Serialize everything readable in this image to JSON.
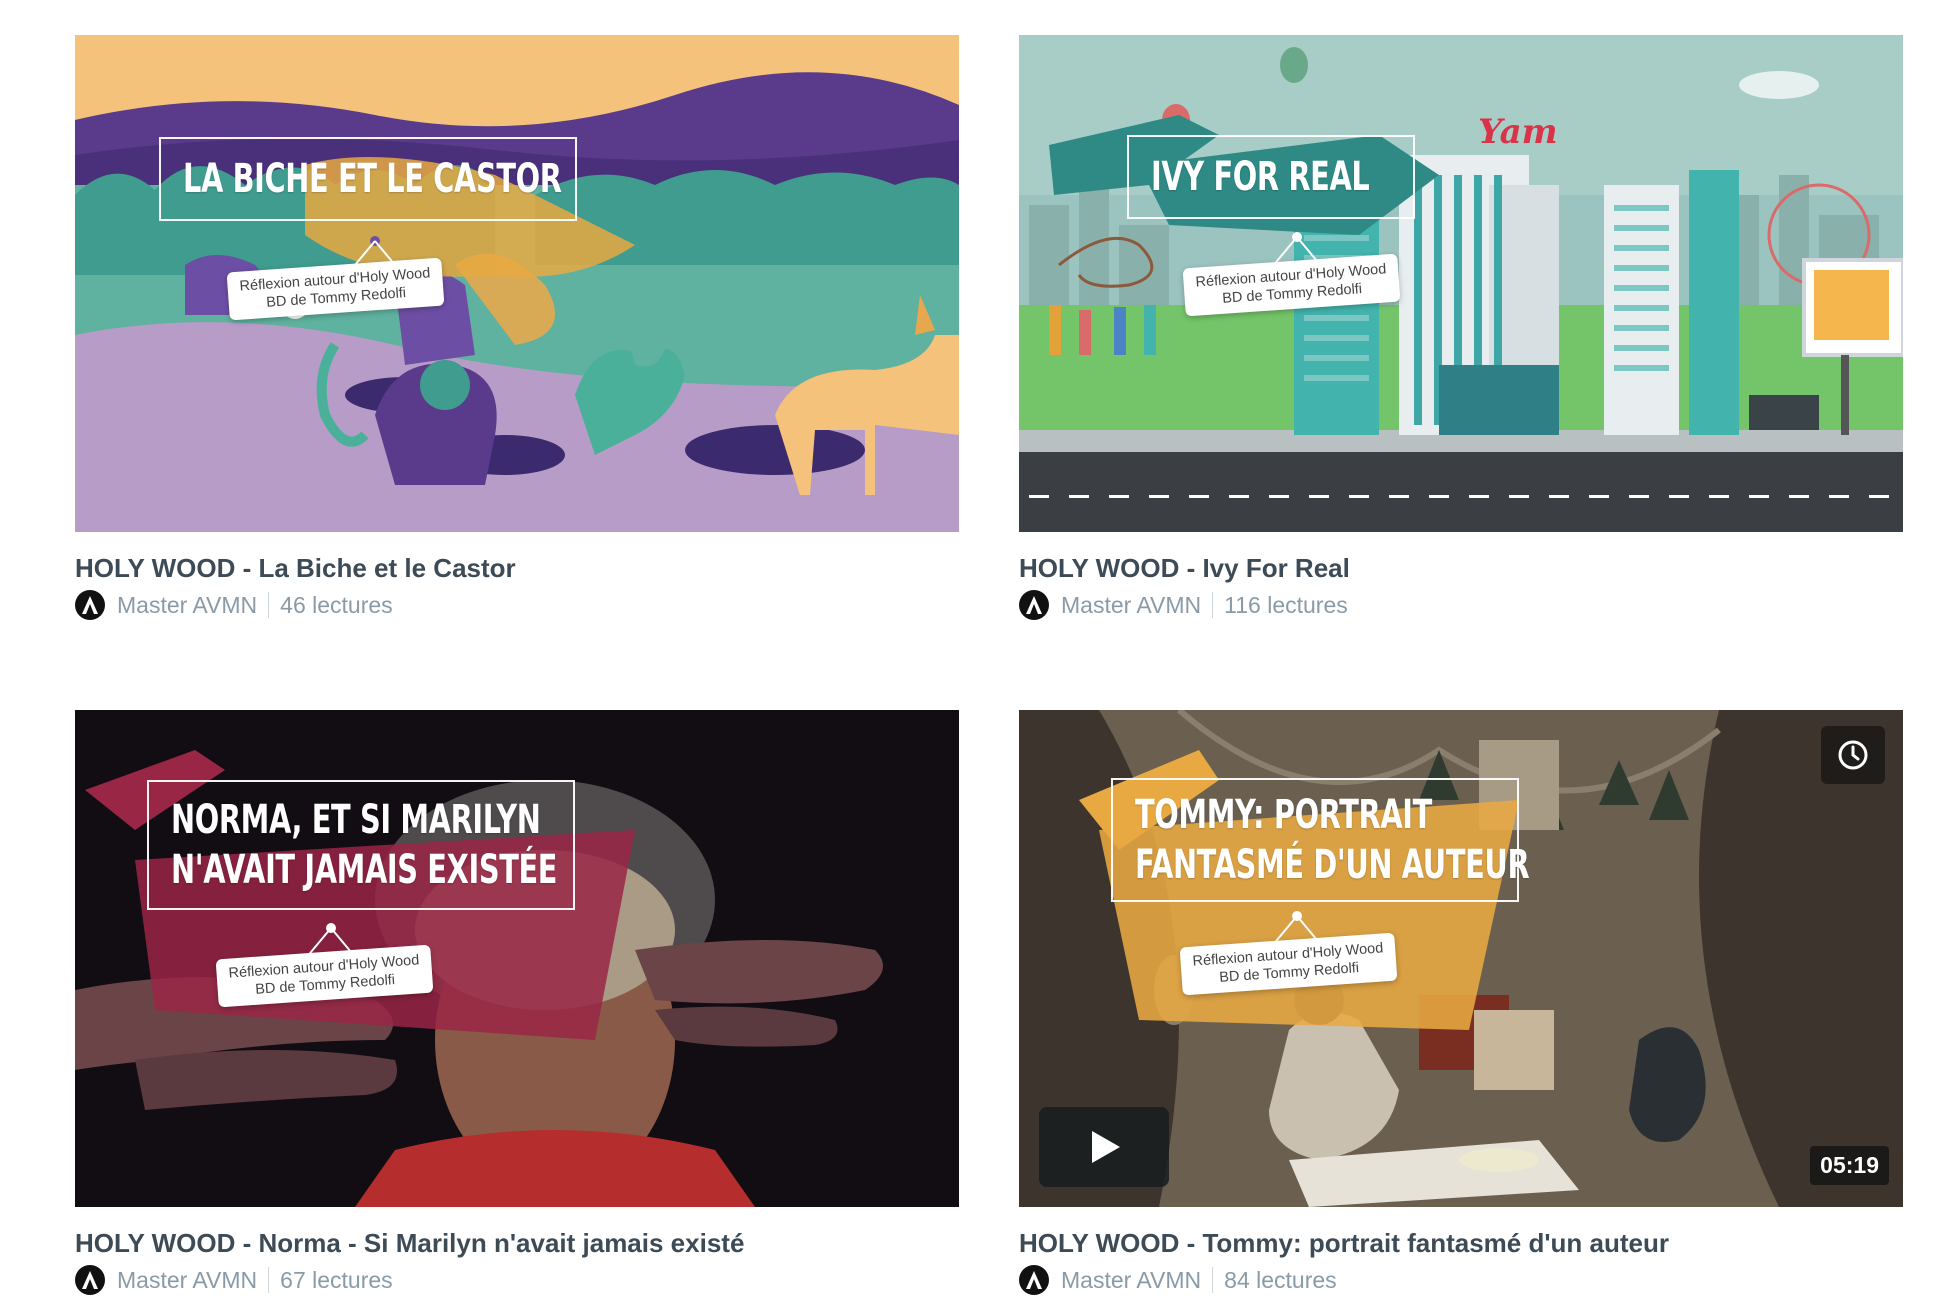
{
  "videos": [
    {
      "thumb_title_lines": [
        "LA BICHE ET LE CASTOR"
      ],
      "sign_lines": [
        "Réflexion autour d'Holy Wood",
        "BD de Tommy Redolfi"
      ],
      "title": "HOLY WOOD - La Biche et le Castor",
      "author": "Master AVMN",
      "views": "46 lectures"
    },
    {
      "thumb_title_lines": [
        "IVY FOR REAL"
      ],
      "sign_lines": [
        "Réflexion autour d'Holy Wood",
        "BD de Tommy Redolfi"
      ],
      "billboard_text": "Yam",
      "title": "HOLY WOOD - Ivy For Real",
      "author": "Master AVMN",
      "views": "116 lectures"
    },
    {
      "thumb_title_lines": [
        "NORMA, ET SI MARILYN",
        "N'AVAIT JAMAIS EXISTÉE"
      ],
      "sign_lines": [
        "Réflexion autour d'Holy Wood",
        "BD de Tommy Redolfi"
      ],
      "title": "HOLY WOOD - Norma - Si Marilyn n'avait jamais existé",
      "author": "Master AVMN",
      "views": "67 lectures"
    },
    {
      "thumb_title_lines": [
        "TOMMY: PORTRAIT",
        "FANTASMÉ D'UN AUTEUR"
      ],
      "sign_lines": [
        "Réflexion autour d'Holy Wood",
        "BD de Tommy Redolfi"
      ],
      "title": "HOLY WOOD - Tommy: portrait fantasmé d'un auteur",
      "author": "Master AVMN",
      "views": "84 lectures",
      "duration": "05:19",
      "icons": {
        "watch_later": "clock-icon",
        "play": "play-icon"
      }
    }
  ],
  "colors": {
    "title_text": "#3d4b57",
    "meta_text": "#8a9aa6"
  }
}
